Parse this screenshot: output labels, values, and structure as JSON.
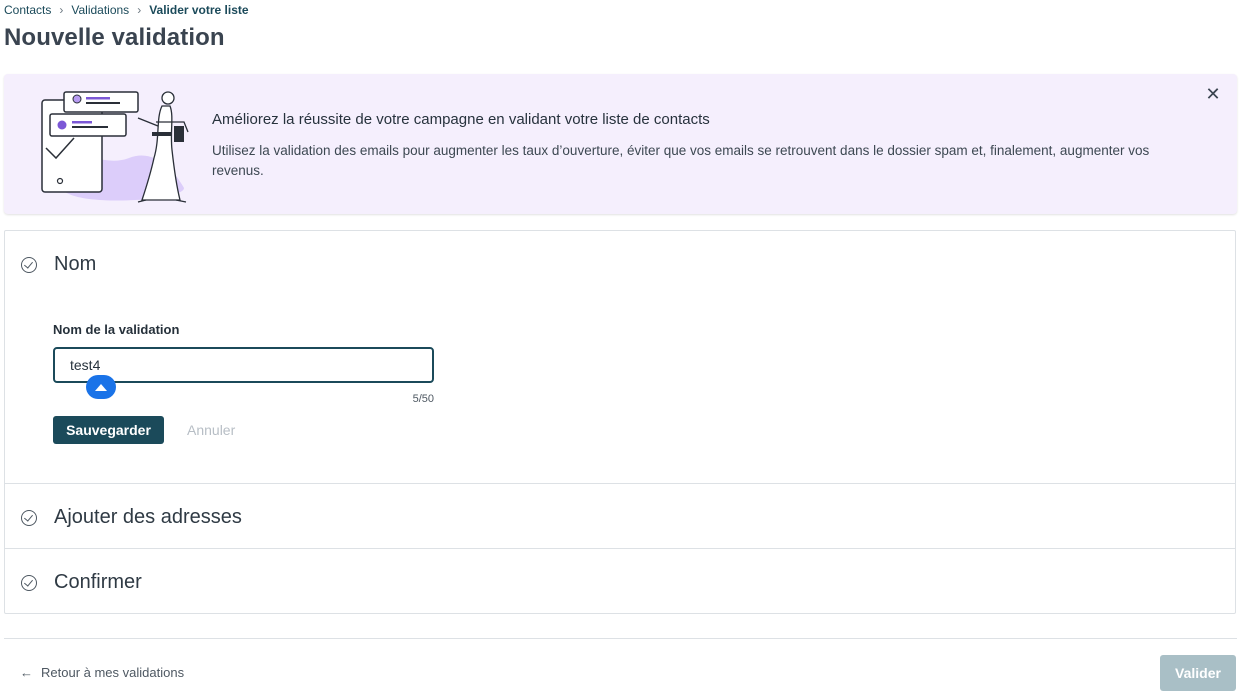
{
  "breadcrumb": {
    "items": [
      "Contacts",
      "Validations"
    ],
    "current": "Valider votre liste",
    "separator": ">"
  },
  "page": {
    "title": "Nouvelle validation"
  },
  "banner": {
    "headline": "Améliorez la réussite de votre campagne en validant votre liste de contacts",
    "description": "Utilisez la validation des emails pour augmenter les taux d’ouverture, éviter que vos emails se retrouvent dans le dossier spam et, finalement, augmenter vos revenus.",
    "close_icon": "close-icon",
    "background": "#f5effd"
  },
  "steps": [
    {
      "title": "Nom",
      "icon": "check-circle-icon"
    },
    {
      "title": "Ajouter des adresses",
      "icon": "check-circle-icon"
    },
    {
      "title": "Confirmer",
      "icon": "check-circle-icon"
    }
  ],
  "name_form": {
    "label": "Nom de la validation",
    "value": "test4",
    "counter": "5/50",
    "save_label": "Sauvegarder",
    "cancel_label": "Annuler"
  },
  "footer": {
    "back_label": "Retour à mes validations",
    "validate_label": "Valider"
  },
  "colors": {
    "primary": "#1b4a5a",
    "disabled_button": "#a9bfc6",
    "cursor_pin": "#1a73e8"
  }
}
